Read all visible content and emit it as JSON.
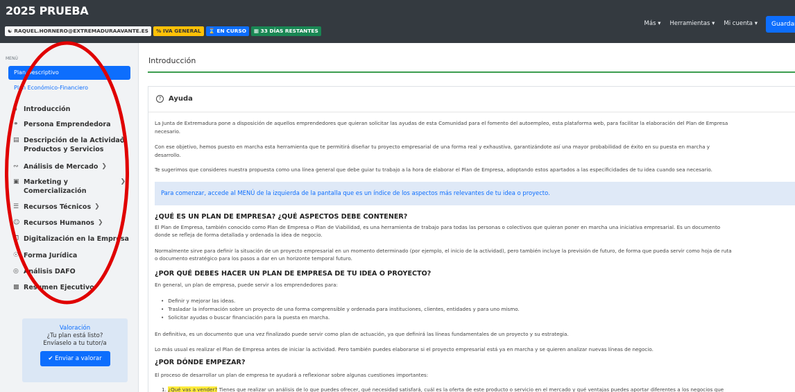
{
  "header": {
    "app_title": "2025 PRUEBA",
    "badges": {
      "user": "RAQUEL.HORNERO@EXTREMADURAAVANTE.ES",
      "iva": "IVA GENERAL",
      "status": "EN CURSO",
      "days": "33 DÍAS RESTANTES"
    },
    "nav": {
      "mas": "Más",
      "herramientas": "Herramientas",
      "cuenta": "Mi cuenta"
    },
    "save_label": "Guardar"
  },
  "sidebar": {
    "menu_label": "MENÚ",
    "plan_descriptivo": "Plan Descriptivo",
    "plan_economico": "Plan Económico-Financiero",
    "items": [
      {
        "label": "Introducción",
        "icon": "home-icon"
      },
      {
        "label": "Persona Emprendedora",
        "icon": "users-icon"
      },
      {
        "label_1": "Descripción de la Actividad,",
        "label_2": "Productos y Servicios",
        "icon": "store-icon"
      },
      {
        "label": "Análisis de Mercado",
        "icon": "chart-icon"
      },
      {
        "label_1": "Marketing y",
        "label_2": "Comercialización",
        "icon": "calendar-icon"
      },
      {
        "label": "Recursos Técnicos",
        "icon": "tools-icon"
      },
      {
        "label": "Recursos Humanos",
        "icon": "people-icon"
      },
      {
        "label": "Digitalización en la Empresa",
        "icon": "copy-icon"
      },
      {
        "label": "Forma Jurídica",
        "icon": "globe-icon"
      },
      {
        "label": "Análisis DAFO",
        "icon": "target-icon"
      },
      {
        "label": "Resumen Ejecutivo",
        "icon": "document-icon"
      }
    ],
    "valoracion": {
      "title": "Valoración",
      "line1": "¿Tu plan está listo?",
      "line2": "Envíaselo a tu tutor/a",
      "button": "Enviar a valorar"
    }
  },
  "main": {
    "section_title": "Introducción",
    "card_title": "Ayuda",
    "p1a": "La Junta de Extremadura pone a disposición de aquellos emprendedores que quieran solicitar las ayudas de esta Comunidad para el fomento del autoempleo, esta plataforma web, para facilitar la elaboración del Plan de Empresa",
    "p1b": "necesario.",
    "p2a": "Con ese objetivo, hemos puesto en marcha esta herramienta que te permitirá diseñar tu proyecto empresarial de una forma real y exhaustiva, garantizándote así una mayor probabilidad de éxito en su puesta en marcha y",
    "p2b": "desarrollo.",
    "p3": "Te sugerimos que consideres nuestra propuesta como una línea general que debe guiar tu trabajo a la hora de elaborar el Plan de Empresa, adoptando estos apartados a las especificidades de tu idea cuando sea necesario.",
    "alert": "Para comenzar, accede al MENÚ de la izquierda de la pantalla que es un índice de los aspectos más relevantes de tu idea o proyecto.",
    "h1": "¿QUÉ ES UN PLAN DE EMPRESA? ¿QUÉ ASPECTOS DEBE CONTENER?",
    "p4a": "El Plan de Empresa, también conocido como Plan de Empresa o Plan de Viabilidad, es una herramienta de trabajo para todas las personas o colectivos que quieran poner en marcha una iniciativa empresarial. Es un documento",
    "p4b": "donde se refleja de forma detallada y ordenada la idea de negocio.",
    "p5a": "Normalmente sirve para definir la situación de un proyecto empresarial en un momento determinado (por ejemplo, el inicio de la actividad), pero también incluye la previsión de futuro, de forma que pueda servir como hoja de ruta",
    "p5b": "o documento estratégico para los pasos a dar en un horizonte temporal futuro.",
    "h2": "¿POR QUÉ DEBES HACER UN PLAN DE EMPRESA DE TU IDEA O PROYECTO?",
    "p6": "En general, un plan de empresa, puede servir a los emprendedores para:",
    "bullets": [
      "Definir y mejorar las ideas.",
      "Trasladar la información sobre un proyecto de una forma comprensible y ordenada para instituciones, clientes, entidades y para uno mismo.",
      "Solicitar ayudas o buscar financiación para la puesta en marcha."
    ],
    "p7": "En definitiva, es un documento que una vez finalizado puede servir como plan de actuación, ya que definirá las líneas fundamentales de un proyecto y su estrategia.",
    "p8": "Lo más usual es realizar el Plan de Empresa antes de iniciar la actividad. Pero también puedes elaborarse si el proyecto empresarial está ya en marcha y se quieren analizar nuevas líneas de negocio.",
    "h3": "¿POR DÓNDE EMPEZAR?",
    "p9": "El proceso de desarrollar un plan de empresa te ayudará a reflexionar sobre algunas cuestiones importantes:",
    "ol_num": "1.",
    "ol_highlight": "¿Qué vas a vender?",
    "ol_text": "Tienes que realizar un análisis de lo que puedes ofrecer, qué necesidad satisfará, cuál es la oferta de este producto o servicio en el mercado y qué ventajas puedes aportar diferentes a los negocios que"
  },
  "colors": {
    "header_bg": "#343a40",
    "primary": "#0d6efd",
    "success": "#198754",
    "warning": "#ffc107",
    "accent_line": "#3c9d4e",
    "annotation": "#e00000"
  }
}
